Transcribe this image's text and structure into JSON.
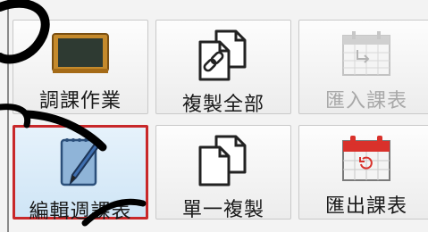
{
  "toolbar": {
    "row1": [
      {
        "label": "調課作業",
        "icon": "chalkboard-icon",
        "enabled": true
      },
      {
        "label": "複製全部",
        "icon": "copy-link-icon",
        "enabled": true
      },
      {
        "label": "匯入課表",
        "icon": "calendar-import-icon",
        "enabled": false
      }
    ],
    "row2": [
      {
        "label": "編輯週課表",
        "icon": "edit-notebook-icon",
        "enabled": true,
        "selected": true
      },
      {
        "label": "單一複製",
        "icon": "copy-icon",
        "enabled": true
      },
      {
        "label": "匯出課表",
        "icon": "calendar-export-icon",
        "enabled": true
      }
    ]
  },
  "colors": {
    "selected_border": "#c8282a",
    "calendar_red": "#d9312b",
    "chalkboard_frame": "#c58a2c",
    "chalkboard_board": "#2e3a32"
  }
}
